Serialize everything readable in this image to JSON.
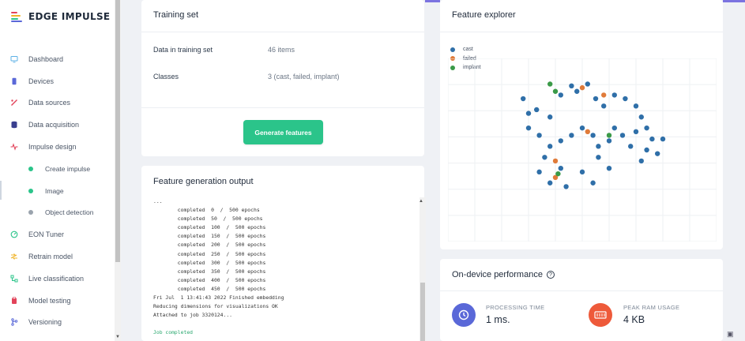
{
  "app": {
    "logo_text": "EDGE IMPULSE"
  },
  "sidebar": {
    "items": [
      {
        "label": "Dashboard",
        "icon": "monitor-icon",
        "color": "#5cb0e6"
      },
      {
        "label": "Devices",
        "icon": "devices-icon",
        "color": "#5a68d8"
      },
      {
        "label": "Data sources",
        "icon": "data-sources-icon",
        "color": "#e2435a"
      },
      {
        "label": "Data acquisition",
        "icon": "database-icon",
        "color": "#3a3f8f"
      },
      {
        "label": "Impulse design",
        "icon": "impulse-icon",
        "color": "#e2435a"
      }
    ],
    "sub_items": [
      {
        "label": "Create impulse",
        "dot_color": "#2bc48a"
      },
      {
        "label": "Image",
        "dot_color": "#2bc48a"
      },
      {
        "label": "Object detection",
        "dot_color": "#9aa3ad"
      }
    ],
    "items_after": [
      {
        "label": "EON Tuner",
        "icon": "tuner-icon",
        "color": "#2bc48a"
      },
      {
        "label": "Retrain model",
        "icon": "retrain-icon",
        "color": "#f0b429"
      },
      {
        "label": "Live classification",
        "icon": "live-icon",
        "color": "#2bc48a"
      },
      {
        "label": "Model testing",
        "icon": "testing-icon",
        "color": "#e2435a"
      },
      {
        "label": "Versioning",
        "icon": "versioning-icon",
        "color": "#5a68d8"
      }
    ]
  },
  "training_set": {
    "title": "Training set",
    "data_label": "Data in training set",
    "data_value": "46 items",
    "classes_label": "Classes",
    "classes_value": "3 (cast, failed, implant)",
    "button_label": "Generate features"
  },
  "feature_output": {
    "title": "Feature generation output",
    "lines": [
      "...",
      "        completed  0  /  500 epochs",
      "        completed  50  /  500 epochs",
      "        completed  100  /  500 epochs",
      "        completed  150  /  500 epochs",
      "        completed  200  /  500 epochs",
      "        completed  250  /  500 epochs",
      "        completed  300  /  500 epochs",
      "        completed  350  /  500 epochs",
      "        completed  400  /  500 epochs",
      "        completed  450  /  500 epochs",
      "Fri Jul  1 13:41:43 2022 Finished embedding",
      "Reducing dimensions for visualizations OK",
      "Attached to job 3320124...",
      "",
      "Job completed"
    ]
  },
  "feature_explorer": {
    "title": "Feature explorer",
    "legend": [
      {
        "label": "cast",
        "color": "#2f6fa8"
      },
      {
        "label": "failed",
        "color": "#e07b39"
      },
      {
        "label": "implant",
        "color": "#3a9a48"
      }
    ]
  },
  "chart_data": {
    "type": "scatter",
    "title": "",
    "xlabel": "",
    "ylabel": "",
    "grid": true,
    "legend_position": "top-left",
    "series": [
      {
        "name": "cast",
        "color": "#2f6fa8",
        "points": [
          [
            0.28,
            0.78
          ],
          [
            0.33,
            0.72
          ],
          [
            0.3,
            0.7
          ],
          [
            0.38,
            0.68
          ],
          [
            0.42,
            0.8
          ],
          [
            0.46,
            0.85
          ],
          [
            0.48,
            0.82
          ],
          [
            0.52,
            0.86
          ],
          [
            0.55,
            0.78
          ],
          [
            0.58,
            0.74
          ],
          [
            0.62,
            0.8
          ],
          [
            0.66,
            0.78
          ],
          [
            0.7,
            0.74
          ],
          [
            0.72,
            0.68
          ],
          [
            0.74,
            0.62
          ],
          [
            0.76,
            0.56
          ],
          [
            0.74,
            0.5
          ],
          [
            0.72,
            0.44
          ],
          [
            0.68,
            0.52
          ],
          [
            0.65,
            0.58
          ],
          [
            0.62,
            0.62
          ],
          [
            0.6,
            0.55
          ],
          [
            0.56,
            0.52
          ],
          [
            0.54,
            0.58
          ],
          [
            0.5,
            0.62
          ],
          [
            0.46,
            0.58
          ],
          [
            0.42,
            0.55
          ],
          [
            0.38,
            0.52
          ],
          [
            0.34,
            0.58
          ],
          [
            0.3,
            0.62
          ],
          [
            0.36,
            0.46
          ],
          [
            0.34,
            0.38
          ],
          [
            0.38,
            0.32
          ],
          [
            0.42,
            0.4
          ],
          [
            0.44,
            0.3
          ],
          [
            0.5,
            0.38
          ],
          [
            0.56,
            0.46
          ],
          [
            0.6,
            0.4
          ],
          [
            0.54,
            0.32
          ],
          [
            0.7,
            0.6
          ],
          [
            0.78,
            0.48
          ],
          [
            0.8,
            0.56
          ]
        ]
      },
      {
        "name": "failed",
        "color": "#e07b39",
        "points": [
          [
            0.5,
            0.84
          ],
          [
            0.58,
            0.8
          ],
          [
            0.52,
            0.6
          ],
          [
            0.4,
            0.44
          ],
          [
            0.4,
            0.35
          ]
        ]
      },
      {
        "name": "implant",
        "color": "#3a9a48",
        "points": [
          [
            0.38,
            0.86
          ],
          [
            0.4,
            0.82
          ],
          [
            0.6,
            0.58
          ],
          [
            0.41,
            0.37
          ]
        ]
      }
    ]
  },
  "performance": {
    "title": "On-device performance",
    "processing_time_label": "PROCESSING TIME",
    "processing_time_value": "1 ms.",
    "peak_ram_label": "PEAK RAM USAGE",
    "peak_ram_value": "4 KB"
  }
}
